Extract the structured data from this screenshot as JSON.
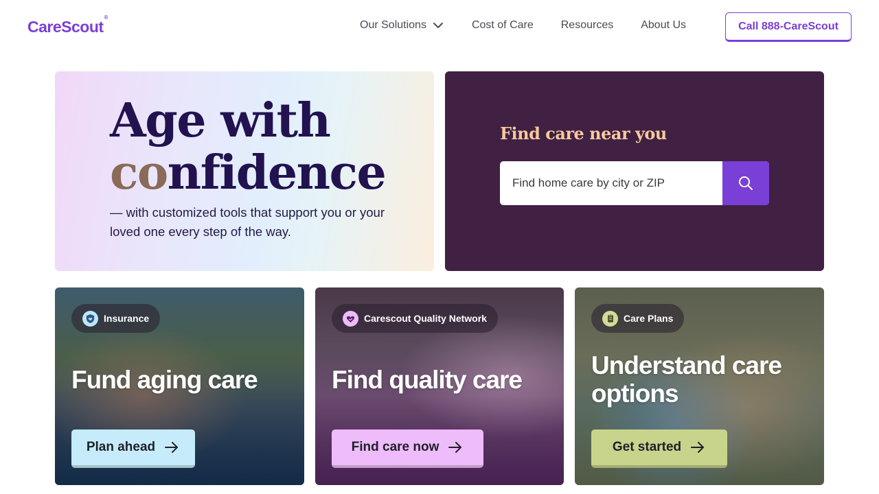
{
  "header": {
    "logo": "CareScout",
    "logo_mark": "®",
    "nav": [
      {
        "label": "Our Solutions",
        "has_dropdown": true
      },
      {
        "label": "Cost of Care"
      },
      {
        "label": "Resources"
      },
      {
        "label": "About Us"
      }
    ],
    "call_label": "Call 888-CareScout"
  },
  "hero": {
    "title_line1": "Age with",
    "title_line2_accent": "co",
    "title_line2_rest": "nfidence",
    "subtitle": "— with customized tools that support you or your loved one every step of the way."
  },
  "find_care": {
    "title": "Find care near you",
    "placeholder": "Find home care by city or ZIP",
    "search_icon": "search-icon"
  },
  "cards": [
    {
      "badge": "Insurance",
      "badge_icon": "shield-heart-icon",
      "title": "Fund aging care",
      "button": "Plan ahead",
      "button_color": "#c6ecfb",
      "badge_icon_color": "#bde6fb"
    },
    {
      "badge": "Carescout Quality Network",
      "badge_icon": "heart-icon",
      "title": "Find quality care",
      "button": "Find care now",
      "button_color": "#eebcfa",
      "badge_icon_color": "#eebcfa"
    },
    {
      "badge": "Care Plans",
      "badge_icon": "clipboard-icon",
      "title": "Understand care options",
      "button": "Get started",
      "button_color": "#c8d48c",
      "badge_icon_color": "#d2dc98"
    }
  ],
  "colors": {
    "brand_purple": "#7a3fd6",
    "hero_dark": "#402043",
    "find_title": "#f6c99a"
  }
}
